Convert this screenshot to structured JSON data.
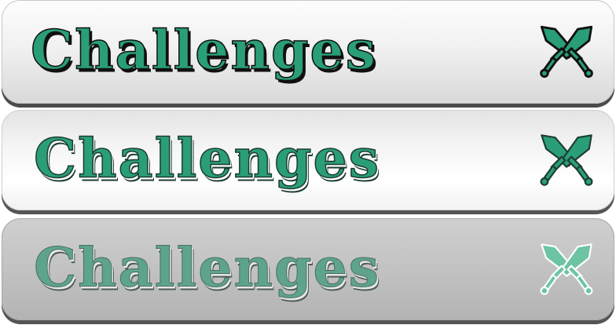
{
  "buttons": [
    {
      "state": "normal",
      "label": "Challenges",
      "icon": "crossed-swords-icon",
      "colors": {
        "text": "#2a9e78",
        "icon": "#2a9e78",
        "background": "#f1f1f1"
      }
    },
    {
      "state": "hover",
      "label": "Challenges",
      "icon": "crossed-swords-icon",
      "colors": {
        "text": "#2a9e78",
        "icon": "#2a9e78",
        "background": "#ffffff"
      }
    },
    {
      "state": "disabled",
      "label": "Challenges",
      "icon": "crossed-swords-icon",
      "colors": {
        "text": "#5ea48c",
        "icon": "#6cc4a2",
        "background": "#c2c2c2"
      }
    }
  ]
}
